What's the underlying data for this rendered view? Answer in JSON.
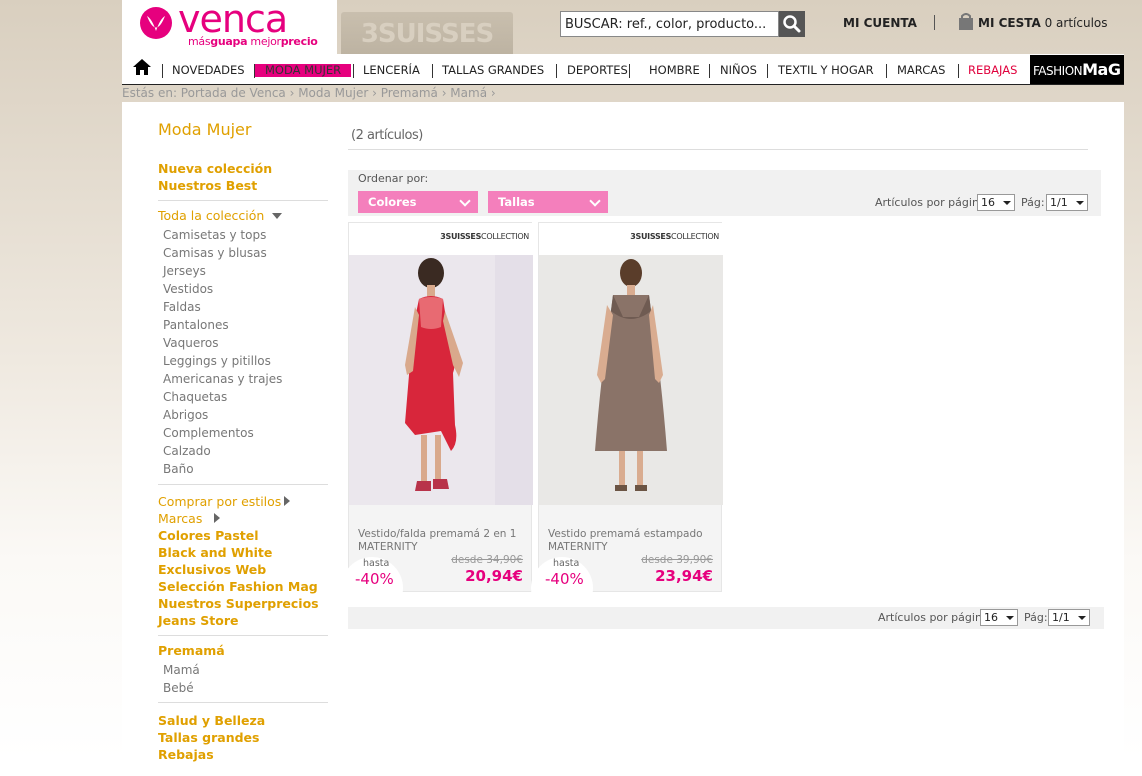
{
  "header": {
    "logo_word": "venca",
    "logo_tag_1": "más",
    "logo_tag_2": "guapa",
    "logo_tag_3": " mejor",
    "logo_tag_4": "precio",
    "partner_tab": "3SUISSES",
    "search_value": "BUSCAR: ref., color, producto...",
    "account": "MI CUENTA",
    "cart_label": "MI CESTA",
    "cart_count": "0 artículos"
  },
  "nav": {
    "items": [
      "NOVEDADES",
      "MODA MUJER",
      "LENCERÍA",
      "TALLAS GRANDES",
      "DEPORTES",
      "HOMBRE",
      "NIÑOS",
      "TEXTIL Y HOGAR",
      "MARCAS",
      "REBAJAS"
    ],
    "fashionmag_1": "FASHION",
    "fashionmag_2": "MaG"
  },
  "breadcrumb": "Estás en: Portada de Venca › Moda Mujer › Premamá › Mamá ›",
  "sidebar": {
    "title": "Moda Mujer",
    "top_links": [
      "Nueva colección",
      "Nuestros Best"
    ],
    "collection_label": "Toda la colección",
    "categories": [
      "Camisetas y tops",
      "Camisas y blusas",
      "Jerseys",
      "Vestidos",
      "Faldas",
      "Pantalones",
      "Vaqueros",
      "Leggings y pitillos",
      "Americanas y trajes",
      "Chaquetas",
      "Abrigos",
      "Complementos",
      "Calzado",
      "Baño"
    ],
    "styles_label": "Comprar por estilos",
    "brands_label": "Marcas",
    "bold_links": [
      "Colores Pastel",
      "Black and White",
      "Exclusivos Web",
      "Selección Fashion Mag",
      "Nuestros Superprecios",
      "Jeans Store"
    ],
    "premama_label": "Premamá",
    "premama_items": [
      "Mamá",
      "Bebé"
    ],
    "bottom_links": [
      "Salud y Belleza",
      "Tallas grandes",
      "Rebajas"
    ]
  },
  "content": {
    "count": "(2 artículos)",
    "sort_label": "Ordenar por:",
    "filter_colors": "Colores",
    "filter_sizes": "Tallas",
    "per_page_label": "Artículos por página:",
    "per_page_value": "16",
    "page_label": "Pág:",
    "page_value": "1/1"
  },
  "products": [
    {
      "brand_1": "3SUISSES",
      "brand_2": "COLLECTION",
      "name": "Vestido/falda premamá 2 en 1 MATERNITY",
      "old_price": "desde 34,90€",
      "price": "20,94€",
      "hasta": "hasta",
      "discount": "-40%"
    },
    {
      "brand_1": "3SUISSES",
      "brand_2": "COLLECTION",
      "name": "Vestido premamá estampado MATERNITY",
      "old_price": "desde 39,90€",
      "price": "23,94€",
      "hasta": "hasta",
      "discount": "-40%"
    }
  ],
  "colors": {
    "brand_pink": "#e6007e",
    "accent_gold": "#e0a000",
    "filter_pink": "#f47fbc",
    "sale_red": "#e0003c"
  }
}
